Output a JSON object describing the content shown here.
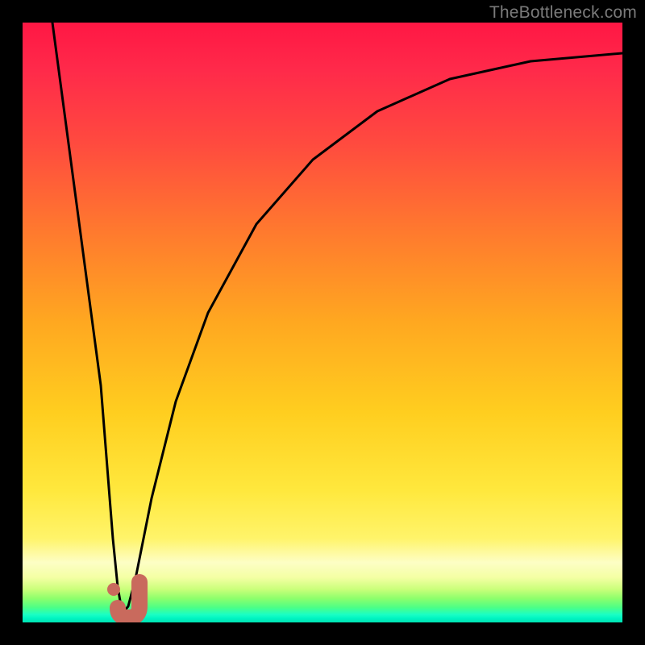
{
  "watermark": "TheBottleneck.com",
  "chart_data": {
    "type": "line",
    "title": "",
    "xlabel": "",
    "ylabel": "",
    "xlim": [
      0,
      100
    ],
    "ylim": [
      0,
      100
    ],
    "grid": false,
    "legend": false,
    "series": [
      {
        "name": "bottleneck-curve",
        "x": [
          5,
          10,
          13,
          15,
          16.5,
          18,
          20,
          25,
          30,
          35,
          40,
          50,
          60,
          70,
          80,
          90,
          100
        ],
        "y": [
          100,
          50,
          12,
          3,
          1.5,
          3,
          10,
          30,
          47,
          59,
          67,
          78,
          84,
          88,
          91,
          93,
          94.5
        ]
      }
    ],
    "marker": {
      "name": "sweet-spot",
      "shape": "J-hook",
      "color": "#cc6b5e",
      "x_range": [
        14.5,
        19
      ],
      "y_range": [
        0.5,
        6
      ]
    },
    "background_gradient": {
      "direction": "vertical",
      "stops": [
        {
          "pos": 0,
          "color": "#ff1744"
        },
        {
          "pos": 0.35,
          "color": "#ff7a2e"
        },
        {
          "pos": 0.65,
          "color": "#ffce1f"
        },
        {
          "pos": 0.9,
          "color": "#fdfec5"
        },
        {
          "pos": 0.96,
          "color": "#8dff6c"
        },
        {
          "pos": 1.0,
          "color": "#00e2b2"
        }
      ]
    }
  }
}
